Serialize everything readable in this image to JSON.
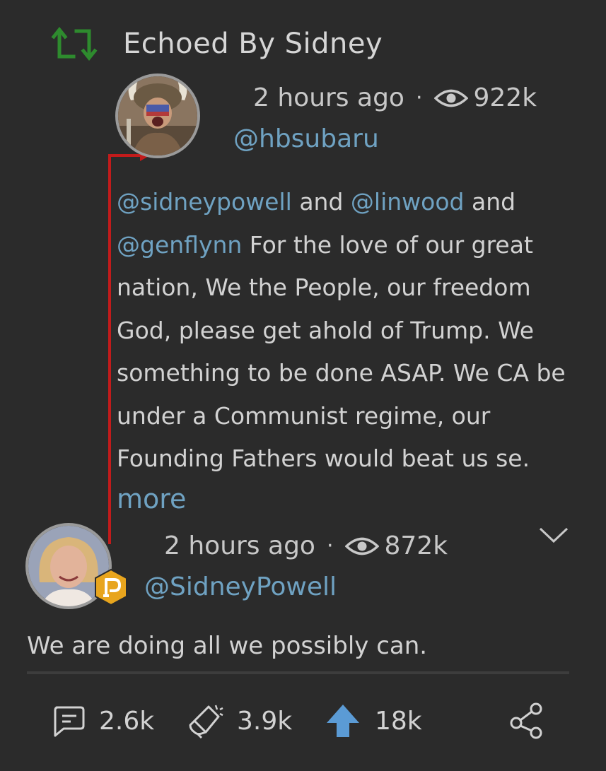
{
  "echo": {
    "label": "Echoed By Sidney",
    "icon": "echo-icon",
    "icon_color": "#2e8b2e"
  },
  "original_post": {
    "time": "2 hours ago",
    "separator": "·",
    "views": "922k",
    "handle": "@hbsubaru",
    "mentions": [
      "@sidneypowell",
      "@linwood",
      "@genflynn"
    ],
    "text_parts": [
      {
        "type": "mention",
        "text": "@sidneypowell"
      },
      {
        "type": "text",
        "text": " and "
      },
      {
        "type": "mention",
        "text": "@linwood"
      },
      {
        "type": "text",
        "text": " and "
      },
      {
        "type": "mention",
        "text": "@genflynn"
      },
      {
        "type": "text",
        "text": " For the love of our great nation, We the People, our freedom God, please get ahold of Trump. We something to be done ASAP. We CA be under a Communist regime, our Founding Fathers would beat us se."
      }
    ],
    "more_label": "more"
  },
  "echo_post": {
    "time": "2 hours ago",
    "separator": "·",
    "views": "872k",
    "handle": "@SidneyPowell",
    "comment": "We are doing all we possibly can.",
    "badge_icon": "parler-badge-icon",
    "badge_color": "#e8a51e",
    "menu_icon": "chevron-down-icon"
  },
  "actions": {
    "comments": "2.6k",
    "echoes": "3.9k",
    "upvotes": "18k",
    "share_icon": "share-icon",
    "upvote_color": "#5b9bd5"
  },
  "colors": {
    "background": "#2b2b2b",
    "link": "#6fa2c2",
    "thread_line": "#c21b1b"
  }
}
